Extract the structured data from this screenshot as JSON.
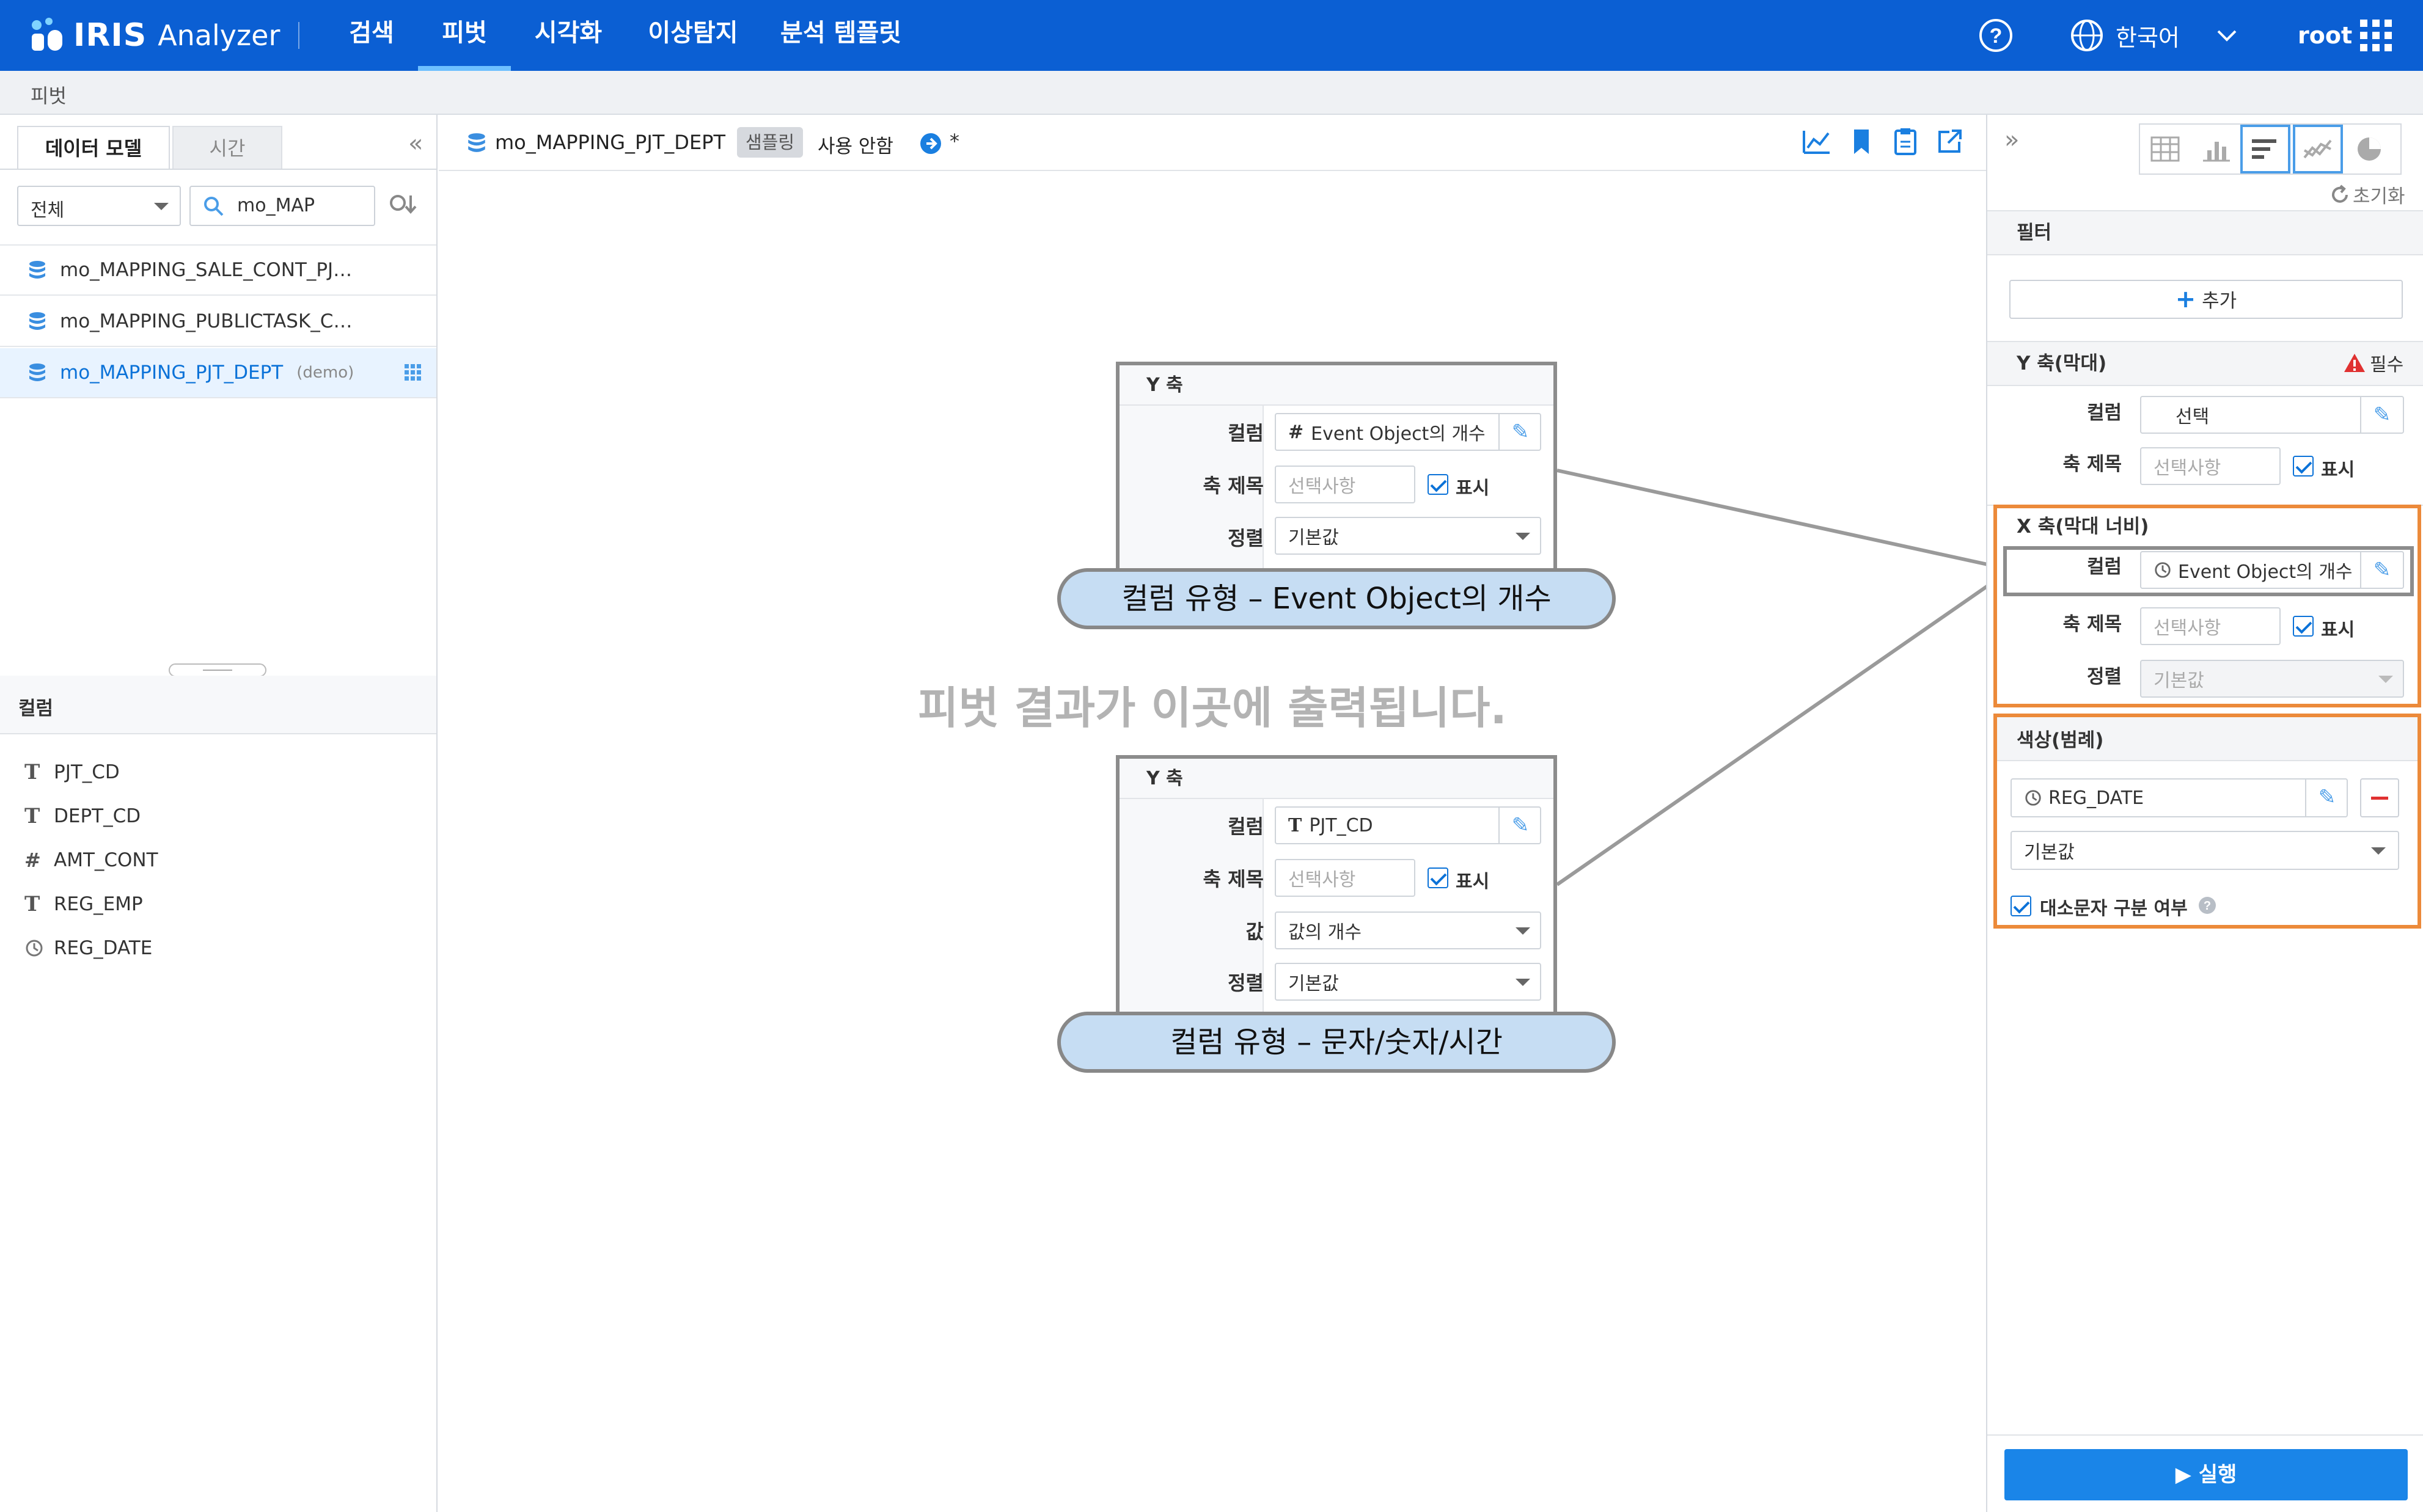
{
  "topbar": {
    "brand": "IRIS",
    "product": "Analyzer",
    "nav": [
      "검색",
      "피벗",
      "시각화",
      "이상탐지",
      "분석 템플릿"
    ],
    "active_nav": "피벗",
    "language": "한국어",
    "user": "root"
  },
  "breadcrumb": "피벗",
  "left": {
    "tabs": [
      "데이터 모델",
      "시간"
    ],
    "scope_select": "전체",
    "search_value": "mo_MAP",
    "tables": [
      {
        "name": "mo_MAPPING_SALE_CONT_PJ…",
        "tag": ""
      },
      {
        "name": "mo_MAPPING_PUBLICTASK_C…",
        "tag": ""
      },
      {
        "name": "mo_MAPPING_PJT_DEPT",
        "tag": "(demo)"
      }
    ],
    "columns_header": "컬럼",
    "columns": [
      {
        "name": "PJT_CD",
        "type": "T"
      },
      {
        "name": "DEPT_CD",
        "type": "T"
      },
      {
        "name": "AMT_CONT",
        "type": "#"
      },
      {
        "name": "REG_EMP",
        "type": "T"
      },
      {
        "name": "REG_DATE",
        "type": "clock"
      }
    ]
  },
  "center": {
    "model_name": "mo_MAPPING_PJT_DEPT",
    "sampling_badge": "샘플링",
    "sampling_state": "사용 안함",
    "modified_mark": "*",
    "empty_message": "피벗 결과가 이곳에 출력됩니다."
  },
  "callout_top": {
    "title": "Y 축",
    "label_column": "컬럼",
    "column_value": "Event Object의 개수",
    "label_axis_title": "축 제목",
    "axis_title_placeholder": "선택사항",
    "show_label": "표시",
    "label_sort": "정렬",
    "sort_value": "기본값",
    "pill": "컬럼 유형 – Event Object의 개수"
  },
  "callout_bottom": {
    "title": "Y 축",
    "label_column": "컬럼",
    "column_value": "PJT_CD",
    "label_axis_title": "축 제목",
    "axis_title_placeholder": "선택사항",
    "show_label": "표시",
    "label_value": "값",
    "value_value": "값의 개수",
    "label_sort": "정렬",
    "sort_value": "기본값",
    "pill": "컬럼 유형 – 문자/숫자/시간"
  },
  "right": {
    "reset": "초기화",
    "filter_header": "필터",
    "add_label": "추가",
    "y_header": "Y 축(막대)",
    "required": "필수",
    "y_column_label": "컬럼",
    "y_column_value": "선택",
    "y_axis_title_label": "축 제목",
    "y_axis_placeholder": "선택사항",
    "show_label": "표시",
    "x_header": "X 축(막대 너비)",
    "x_column_label": "컬럼",
    "x_column_value": "Event Object의 개수",
    "x_axis_title_label": "축 제목",
    "x_axis_placeholder": "선택사항",
    "x_sort_label": "정렬",
    "x_sort_value": "기본값",
    "color_header": "색상(범례)",
    "color_column": "REG_DATE",
    "color_sort": "기본값",
    "case_sensitive": "대소문자 구분 여부",
    "run": "실행"
  },
  "colors": {
    "topbar": "#0b5fd3",
    "accent": "#0b72d8",
    "highlight_orange": "#ec8a3a",
    "callout_fill": "#c6ddf3",
    "required_red": "#e03131"
  }
}
